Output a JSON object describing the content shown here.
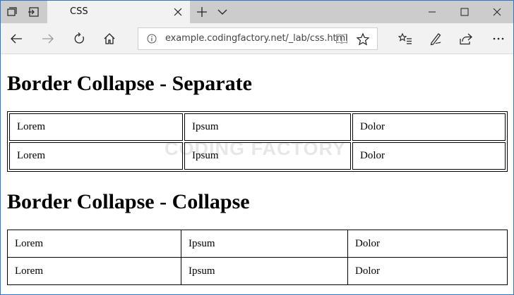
{
  "browser": {
    "tab": {
      "title": "CSS"
    },
    "address_bar": {
      "url": "example.codingfactory.net/_lab/css.html"
    },
    "icons": {
      "tab_actions": "tab-actions-icon",
      "back_tabs": "set-aside-tabs-icon",
      "close_tab": "close-icon",
      "new_tab": "plus-icon",
      "tab_list": "chevron-down-icon",
      "minimize": "minimize-icon",
      "maximize": "maximize-icon",
      "close_window": "close-window-icon",
      "back": "back-arrow-icon",
      "forward": "forward-arrow-icon",
      "refresh": "refresh-icon",
      "home": "home-icon",
      "site_info": "info-icon",
      "reading_view": "book-icon",
      "favorite": "star-icon",
      "favorites_hub": "favorites-list-icon",
      "notes": "pen-icon",
      "share": "share-icon"
    }
  },
  "page": {
    "heading_separate": "Border Collapse - Separate",
    "heading_collapse": "Border Collapse - Collapse",
    "table_separate": {
      "rows": [
        [
          "Lorem",
          "Ipsum",
          "Dolor"
        ],
        [
          "Lorem",
          "Ipsum",
          "Dolor"
        ]
      ]
    },
    "table_collapse": {
      "rows": [
        [
          "Lorem",
          "Ipsum",
          "Dolor"
        ],
        [
          "Lorem",
          "Ipsum",
          "Dolor"
        ]
      ]
    },
    "watermark": "CODING FACTORY"
  },
  "colors": {
    "titlebar": "#cccccc",
    "toolbar": "#f2f2f2",
    "window_border": "#2b78c5"
  }
}
